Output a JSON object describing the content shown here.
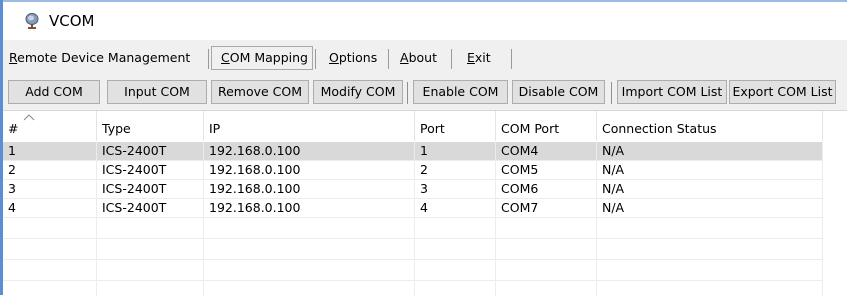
{
  "window": {
    "title": "VCOM",
    "icon": "satellite-dish-icon"
  },
  "menu": {
    "items": [
      {
        "label": "Remote Device Management",
        "accesskey": "R",
        "selected": false
      },
      {
        "label": "COM Mapping",
        "accesskey": "C",
        "selected": true
      },
      {
        "label": "Options",
        "accesskey": "O",
        "selected": false
      },
      {
        "label": "About",
        "accesskey": "A",
        "selected": false
      },
      {
        "label": "Exit",
        "accesskey": "E",
        "selected": false
      }
    ]
  },
  "toolbar": {
    "buttons": [
      {
        "label": "Add COM"
      },
      {
        "label": "Input COM"
      },
      {
        "label": "Remove COM"
      },
      {
        "label": "Modify COM"
      },
      {
        "label": "Enable COM"
      },
      {
        "label": "Disable COM"
      },
      {
        "label": "Import COM List"
      },
      {
        "label": "Export COM List"
      }
    ]
  },
  "table": {
    "sort_icon": "sort-up-icon",
    "columns": [
      "#",
      "Type",
      "IP",
      "Port",
      "COM Port",
      "Connection Status"
    ],
    "rows": [
      {
        "num": "1",
        "type": "ICS-2400T",
        "ip": "192.168.0.100",
        "port": "1",
        "com": "COM4",
        "status": "N/A",
        "selected": true
      },
      {
        "num": "2",
        "type": "ICS-2400T",
        "ip": "192.168.0.100",
        "port": "2",
        "com": "COM5",
        "status": "N/A",
        "selected": false
      },
      {
        "num": "3",
        "type": "ICS-2400T",
        "ip": "192.168.0.100",
        "port": "3",
        "com": "COM6",
        "status": "N/A",
        "selected": false
      },
      {
        "num": "4",
        "type": "ICS-2400T",
        "ip": "192.168.0.100",
        "port": "4",
        "com": "COM7",
        "status": "N/A",
        "selected": false
      }
    ]
  },
  "colors": {
    "selected_row": "#d9d9d9",
    "toolbar_bg": "#f0f0f0",
    "button_bg": "#e1e1e1",
    "frame_accent": "#5b8fd1"
  }
}
